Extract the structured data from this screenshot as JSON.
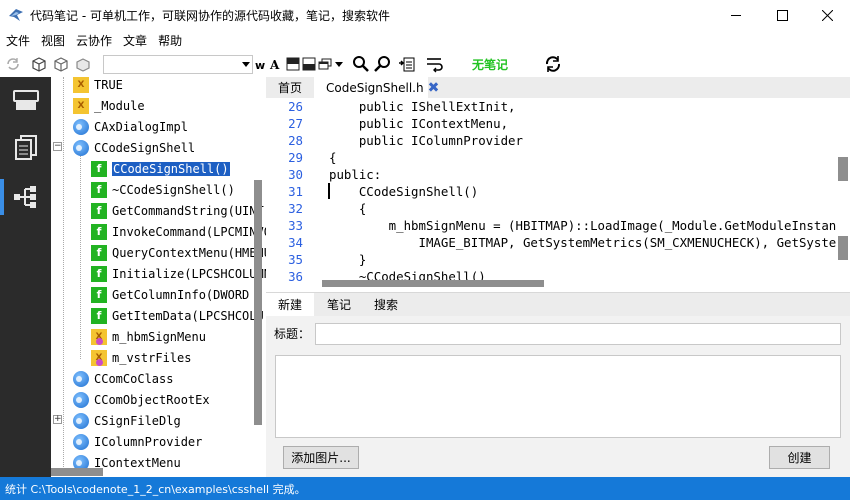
{
  "window": {
    "title": "代码笔记 - 可单机工作，可联网协作的源代码收藏，笔记，搜索软件"
  },
  "menu": [
    "文件",
    "视图",
    "云协作",
    "文章",
    "帮助"
  ],
  "toolbar": {
    "no_note_label": "无笔记",
    "search_value": "",
    "colors": {
      "no_note": "#22c322"
    }
  },
  "tree": {
    "items": [
      {
        "kind": "var",
        "label": "TRUE",
        "indent": 1
      },
      {
        "kind": "var",
        "label": "_Module",
        "indent": 1
      },
      {
        "kind": "class",
        "label": "CAxDialogImpl",
        "indent": 1
      },
      {
        "kind": "class",
        "label": "CCodeSignShell",
        "indent": 1,
        "expander": "−"
      },
      {
        "kind": "fn",
        "label": "CCodeSignShell()",
        "indent": 2,
        "selected": true
      },
      {
        "kind": "fn",
        "label": "~CCodeSignShell()",
        "indent": 2
      },
      {
        "kind": "fn",
        "label": "GetCommandString(UINT",
        "indent": 2
      },
      {
        "kind": "fn",
        "label": "InvokeCommand(LPCMINVO",
        "indent": 2
      },
      {
        "kind": "fn",
        "label": "QueryContextMenu(HMENU",
        "indent": 2
      },
      {
        "kind": "fn",
        "label": "Initialize(LPCSHCOLUMN",
        "indent": 2
      },
      {
        "kind": "fn",
        "label": "GetColumnInfo(DWORD",
        "indent": 2
      },
      {
        "kind": "fn",
        "label": "GetItemData(LPCSHCOLU",
        "indent": 2
      },
      {
        "kind": "member",
        "label": "m_hbmSignMenu",
        "indent": 2
      },
      {
        "kind": "member",
        "label": "m_vstrFiles",
        "indent": 2
      },
      {
        "kind": "class",
        "label": "CComCoClass",
        "indent": 1
      },
      {
        "kind": "class",
        "label": "CComObjectRootEx",
        "indent": 1
      },
      {
        "kind": "class",
        "label": "CSignFileDlg",
        "indent": 1,
        "expander": "+"
      },
      {
        "kind": "class",
        "label": "IColumnProvider",
        "indent": 1
      },
      {
        "kind": "class",
        "label": "IContextMenu",
        "indent": 1
      }
    ]
  },
  "editor": {
    "tabs": {
      "home": "首页",
      "file": "CodeSignShell.h"
    },
    "lines": [
      {
        "n": "26",
        "text": "    public IShellExtInit,"
      },
      {
        "n": "27",
        "text": "    public IContextMenu,"
      },
      {
        "n": "28",
        "text": "    public IColumnProvider"
      },
      {
        "n": "29",
        "text": "{"
      },
      {
        "n": "30",
        "text": "public:"
      },
      {
        "n": "31",
        "text": "    CCodeSignShell()"
      },
      {
        "n": "32",
        "text": "    {"
      },
      {
        "n": "33",
        "text": "        m_hbmSignMenu = (HBITMAP)::LoadImage(_Module.GetModuleInstan"
      },
      {
        "n": "34",
        "text": "            IMAGE_BITMAP, GetSystemMetrics(SM_CXMENUCHECK), GetSyste"
      },
      {
        "n": "35",
        "text": "    }"
      },
      {
        "n": "36",
        "text": "    ~CCodeSignShell()"
      }
    ]
  },
  "notes": {
    "tabs": [
      "新建",
      "笔记",
      "搜索"
    ],
    "title_label": "标题：",
    "title_value": "",
    "body_value": "",
    "add_image_button": "添加图片...",
    "create_button": "创建"
  },
  "status": {
    "text": "统计 C:\\Tools\\codenote_1_2_cn\\examples\\csshell 完成。"
  }
}
